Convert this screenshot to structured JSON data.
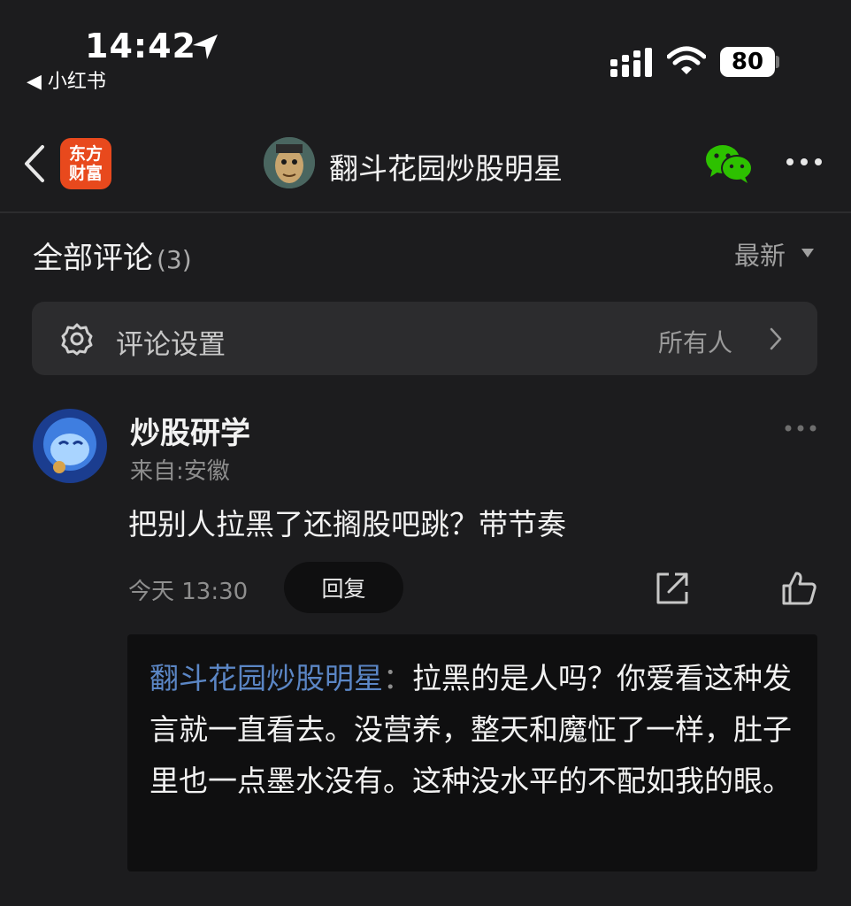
{
  "status_bar": {
    "time": "14:42",
    "back_app": "◀ 小红书",
    "battery": "80"
  },
  "nav": {
    "logo_line1": "东方",
    "logo_line2": "财富",
    "title": "翻斗花园炒股明星"
  },
  "comments_header": {
    "title": "全部评论",
    "count": "(3)",
    "sort_label": "最新"
  },
  "settings": {
    "label": "评论设置",
    "value": "所有人"
  },
  "comment": {
    "author": "炒股研学",
    "location": "来自:安徽",
    "text": "把别人拉黑了还搁股吧跳？带节奏",
    "time": "今天 13:30",
    "reply_button": "回复"
  },
  "reply": {
    "author": "翻斗花园炒股明星",
    "separator": "：",
    "text": "拉黑的是人吗？你爱看这种发言就一直看去。没营养，整天和魔怔了一样，肚子里也一点墨水没有。这种没水平的不配如我的眼。"
  },
  "colors": {
    "background": "#1c1c1e",
    "card": "#2c2c2e",
    "reply_author": "#5b86c5",
    "logo": "#e8491d",
    "wechat": "#2dc100"
  }
}
